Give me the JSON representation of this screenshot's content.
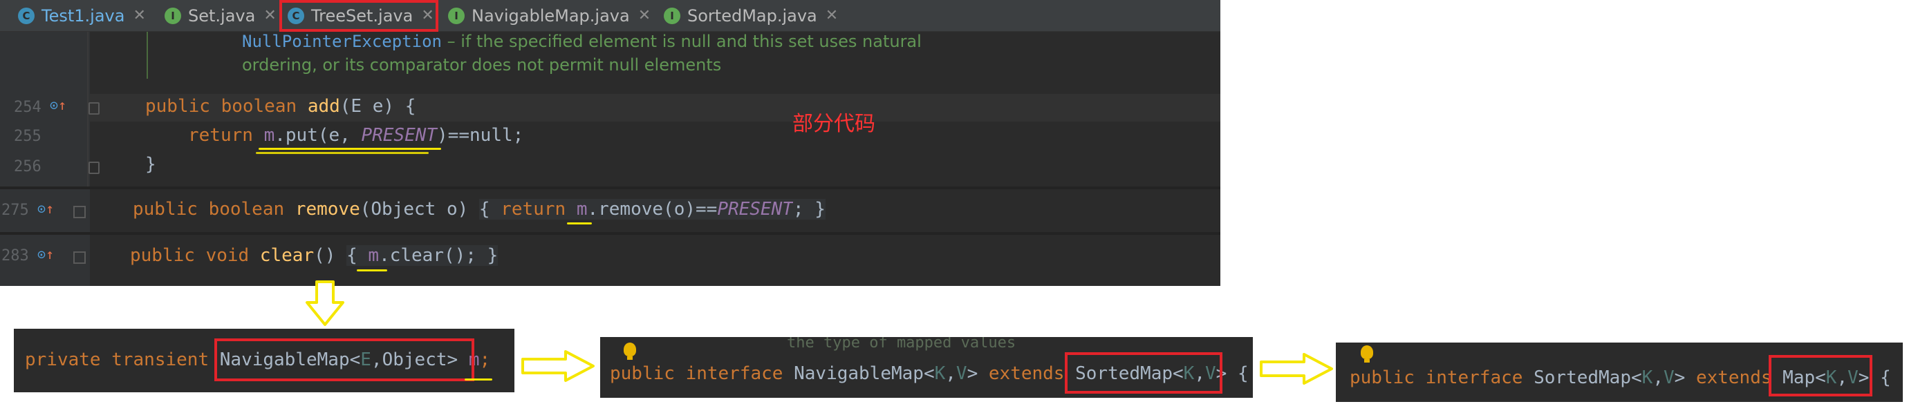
{
  "tabs": [
    {
      "label": "Test1.java",
      "icon": "C"
    },
    {
      "label": "Set.java",
      "icon": "I"
    },
    {
      "label": "TreeSet.java",
      "icon": "C"
    },
    {
      "label": "NavigableMap.java",
      "icon": "I"
    },
    {
      "label": "SortedMap.java",
      "icon": "I"
    }
  ],
  "tab_close_glyph": "✕",
  "doc": {
    "exception": "NullPointerException",
    "line1_rest": " – if the specified element is null and this set uses natural",
    "line2": "ordering, or its comparator does not permit null elements"
  },
  "line_numbers": [
    "254",
    "255",
    "256",
    "275",
    "283"
  ],
  "code": {
    "add_kw": "public boolean ",
    "add_fn": "add",
    "add_rest": "(E e) {",
    "return_kw": "return ",
    "put_field": "m",
    "put_call": ".put(e, ",
    "put_present": "PRESENT",
    "put_rest": ")==null;",
    "close_brace": "}",
    "remove_kw": "public boolean ",
    "remove_fn": "remove",
    "remove_args": "(Object o) ",
    "remove_body_open": "{ ",
    "remove_return": "return ",
    "remove_field": "m",
    "remove_call": ".remove(o)==",
    "remove_present": "PRESENT",
    "remove_body_close": "; }",
    "clear_kw": "public void ",
    "clear_fn": "clear",
    "clear_args": "() ",
    "clear_open": "{ ",
    "clear_field": "m",
    "clear_call": ".clear(); }"
  },
  "annotation": "部分代码",
  "panel1": {
    "mods": "private transient ",
    "type_name": "NavigableMap<",
    "type_e": "E",
    "type_rest": ",Object>",
    "field": "m",
    "semi": ";"
  },
  "panel2": {
    "faded_comment": "the type of mapped values",
    "kw": "public interface ",
    "name": "NavigableMap<",
    "k": "K",
    "comma": ",",
    "v": "V",
    "gt": "> ",
    "extends": "extends ",
    "sup": "SortedMap<",
    "sup_k": "K",
    "sup_comma": ",",
    "sup_v": "V",
    "sup_gt": ">",
    "brace": " {"
  },
  "panel3": {
    "kw": "public interface ",
    "name": "SortedMap<",
    "k": "K",
    "comma": ",",
    "v": "V",
    "gt": "> ",
    "extends": "extends ",
    "sup": "Map<",
    "sup_k": "K",
    "sup_comma": ",",
    "sup_v": "V",
    "sup_gt": ">",
    "brace": " {"
  },
  "colors": {
    "highlight_red": "#e2232a",
    "marker_yellow": "#f5e600",
    "annotation_red": "#ff3333"
  }
}
